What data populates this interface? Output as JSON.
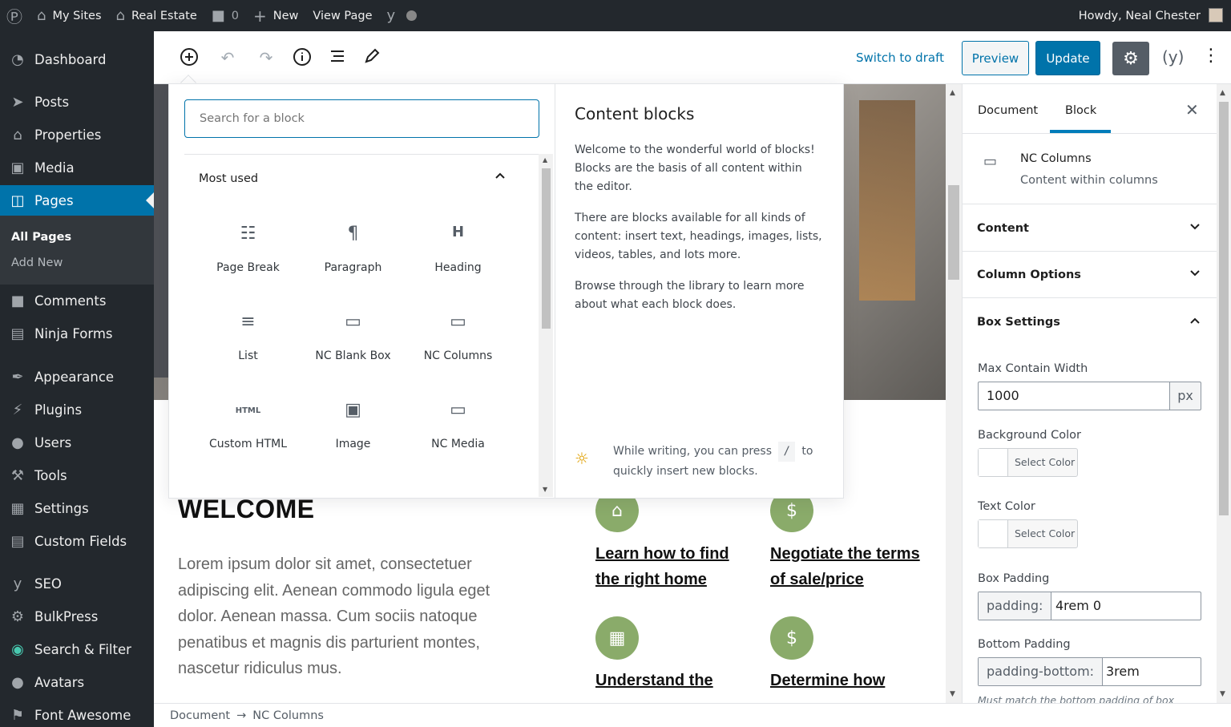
{
  "adminbar": {
    "my_sites": "My Sites",
    "site_name": "Real Estate",
    "comments_count": "0",
    "new_label": "New",
    "view_page": "View Page",
    "howdy": "Howdy, Neal Chester"
  },
  "sidebar": {
    "items": [
      {
        "label": "Dashboard",
        "icon": "dashboard-icon"
      },
      {
        "label": "Posts",
        "icon": "pin-icon"
      },
      {
        "label": "Properties",
        "icon": "house-icon"
      },
      {
        "label": "Media",
        "icon": "media-icon"
      },
      {
        "label": "Pages",
        "icon": "page-icon"
      },
      {
        "label": "Comments",
        "icon": "comment-icon"
      },
      {
        "label": "Ninja Forms",
        "icon": "form-icon"
      },
      {
        "label": "Appearance",
        "icon": "brush-icon"
      },
      {
        "label": "Plugins",
        "icon": "plugin-icon"
      },
      {
        "label": "Users",
        "icon": "user-icon"
      },
      {
        "label": "Tools",
        "icon": "wrench-icon"
      },
      {
        "label": "Settings",
        "icon": "sliders-icon"
      },
      {
        "label": "Custom Fields",
        "icon": "fields-icon"
      },
      {
        "label": "SEO",
        "icon": "yoast-icon"
      },
      {
        "label": "BulkPress",
        "icon": "gear-icon"
      },
      {
        "label": "Search & Filter",
        "icon": "search-filter-icon"
      },
      {
        "label": "Avatars",
        "icon": "avatar-icon"
      },
      {
        "label": "Font Awesome",
        "icon": "flag-icon"
      }
    ],
    "submenu": [
      "All Pages",
      "Add New"
    ]
  },
  "toolbar": {
    "switch_to_draft": "Switch to draft",
    "preview": "Preview",
    "update": "Update"
  },
  "inserter": {
    "search_placeholder": "Search for a block",
    "section_title": "Most used",
    "blocks": [
      {
        "label": "Page Break",
        "icon": "page-break-icon"
      },
      {
        "label": "Paragraph",
        "icon": "paragraph-icon"
      },
      {
        "label": "Heading",
        "icon": "heading-icon"
      },
      {
        "label": "List",
        "icon": "list-icon"
      },
      {
        "label": "NC Blank Box",
        "icon": "box-icon"
      },
      {
        "label": "NC Columns",
        "icon": "box-icon"
      },
      {
        "label": "Custom HTML",
        "icon": "html-icon"
      },
      {
        "label": "Image",
        "icon": "image-icon"
      },
      {
        "label": "NC Media",
        "icon": "box-icon"
      }
    ],
    "info_title": "Content blocks",
    "info_paragraphs": [
      "Welcome to the wonderful world of blocks! Blocks are the basis of all content within the editor.",
      "There are blocks available for all kinds of content: insert text, headings, images, lists, videos, tables, and lots more.",
      "Browse through the library to learn more about what each block does."
    ],
    "tip_before": "While writing, you can press",
    "tip_key": "/",
    "tip_after": "to quickly insert new blocks."
  },
  "canvas": {
    "welcome": "WELCOME",
    "lorem": "Lorem ipsum dolor sit amet, consectetuer adipiscing elit. Aenean commodo ligula eget dolor. Aenean massa. Cum sociis natoque penatibus et magnis dis parturient montes, nascetur ridiculus mus.",
    "features": [
      "Learn how to find the right home",
      "Negotiate the terms of sale/price",
      "Understand the",
      "Determine how"
    ],
    "accent_color": "#8aab6a"
  },
  "settings_sidebar": {
    "tab_document": "Document",
    "tab_block": "Block",
    "block_name": "NC Columns",
    "block_desc": "Content within columns",
    "panels": {
      "content": "Content",
      "column_options": "Column Options",
      "box_settings": "Box Settings"
    },
    "max_width_label": "Max Contain Width",
    "max_width_value": "1000",
    "max_width_unit": "px",
    "bg_color_label": "Background Color",
    "text_color_label": "Text Color",
    "select_color": "Select Color",
    "box_padding_label": "Box Padding",
    "box_padding_prefix": "padding:",
    "box_padding_value": "4rem 0",
    "bottom_padding_label": "Bottom Padding",
    "bottom_padding_prefix": "padding-bottom:",
    "bottom_padding_value": "3rem",
    "must_match": "Must match the bottom padding of box"
  },
  "footer": {
    "crumb_document": "Document",
    "crumb_block": "NC Columns"
  },
  "colors": {
    "admin_dark": "#23282d",
    "wp_blue": "#0073aa"
  }
}
